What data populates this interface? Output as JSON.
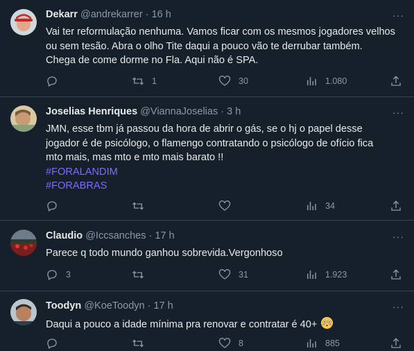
{
  "tweets": [
    {
      "name": "Dekarr",
      "handle": "@andrekarrer",
      "time": "16 h",
      "lines": [
        "Vai ter reformulação nenhuma. Vamos ficar com os mesmos jogadores velhos",
        "ou sem tesão. Abra o olho Tite daqui a pouco vão te derrubar também.",
        "Chega de come dorme no Fla. Aqui não é SPA."
      ],
      "hashtags": [],
      "replies": "",
      "retweets": "1",
      "likes": "30",
      "views": "1.080"
    },
    {
      "name": "Joselias Henriques",
      "handle": "@ViannaJoselias",
      "time": "3 h",
      "lines": [
        "JMN, esse tbm já passou da hora de abrir o gás, se o hj o papel desse",
        "jogador é de psicólogo, o flamengo contratando o psicólogo de ofício fica",
        "mto mais, mas mto e mto mais barato !!"
      ],
      "hashtags": [
        "#FORALANDIM",
        "#FORABRAS"
      ],
      "replies": "",
      "retweets": "",
      "likes": "",
      "views": "34"
    },
    {
      "name": "Claudio",
      "handle": "@Iccsanches",
      "time": "17 h",
      "lines": [
        "Parece q todo mundo ganhou sobrevida.Vergonhoso"
      ],
      "hashtags": [],
      "replies": "3",
      "retweets": "",
      "likes": "31",
      "views": "1.923"
    },
    {
      "name": "Toodyn",
      "handle": "@KoeToodyn",
      "time": "17 h",
      "lines": [
        "Daqui a pouco a idade mínima pra renovar e contratar é 40+"
      ],
      "hashtags": [],
      "replies": "",
      "retweets": "",
      "likes": "8",
      "views": "885"
    }
  ],
  "separator": "·",
  "more_label": "···",
  "icons": {
    "reply": "reply-icon",
    "retweet": "retweet-icon",
    "like": "heart-icon",
    "views": "views-icon",
    "share": "share-icon",
    "flushed_emoji": "flushed-face-emoji"
  },
  "colors": {
    "background": "#15202b",
    "text": "#e7e9ea",
    "muted": "#8b98a5",
    "hashtag": "#7d6cf7",
    "divider": "#38444d"
  }
}
